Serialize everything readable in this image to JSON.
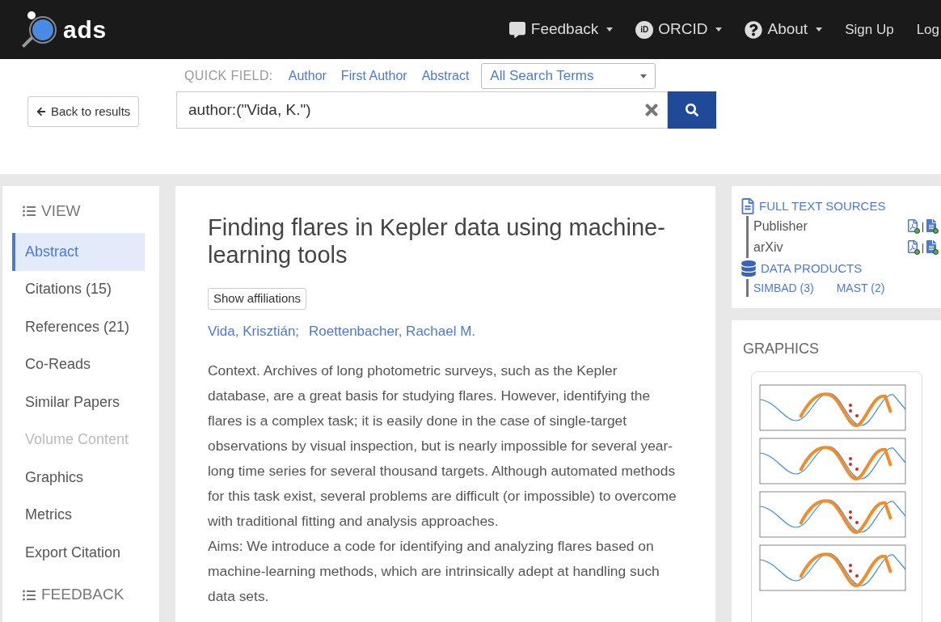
{
  "header": {
    "logo": "ads",
    "nav": [
      {
        "kind": "feedback",
        "label": "Feedback",
        "caret": true
      },
      {
        "kind": "orcid",
        "label": "ORCID",
        "caret": true,
        "badge": "iD"
      },
      {
        "kind": "about",
        "label": "About",
        "caret": true
      },
      {
        "kind": "plain",
        "label": "Sign Up",
        "caret": false
      },
      {
        "kind": "plain",
        "label": "Log",
        "caret": false
      }
    ]
  },
  "search": {
    "back": "Back to results",
    "quick_field_label": "QUICK FIELD:",
    "quick_fields": [
      "Author",
      "First Author",
      "Abstract"
    ],
    "terms_select": "All Search Terms",
    "query": "author:(\"Vida, K.\")"
  },
  "sidebar": {
    "view_heading": "VIEW",
    "items": [
      {
        "label": "Abstract",
        "selected": true,
        "disabled": false
      },
      {
        "label": "Citations (15)",
        "selected": false,
        "disabled": false
      },
      {
        "label": "References (21)",
        "selected": false,
        "disabled": false
      },
      {
        "label": "Co-Reads",
        "selected": false,
        "disabled": false
      },
      {
        "label": "Similar Papers",
        "selected": false,
        "disabled": false
      },
      {
        "label": "Volume Content",
        "selected": false,
        "disabled": true
      },
      {
        "label": "Graphics",
        "selected": false,
        "disabled": false
      },
      {
        "label": "Metrics",
        "selected": false,
        "disabled": false
      },
      {
        "label": "Export Citation",
        "selected": false,
        "disabled": false
      }
    ],
    "feedback_heading": "FEEDBACK"
  },
  "article": {
    "title": "Finding flares in Kepler data using machine-learning tools",
    "affiliations_button": "Show affiliations",
    "authors": [
      "Vida, Krisztián;",
      "Roettenbacher, Rachael M."
    ],
    "abstract": [
      "Context. Archives of long photometric surveys, such as the Kepler database, are a great basis for studying flares. However, identifying the flares is a complex task; it is easily done in the case of single-target observations by visual inspection, but is nearly impossible for several year-long time series for several thousand targets. Although automated methods for this task exist, several problems are difficult (or impossible) to overcome with traditional fitting and analysis approaches.",
      "Aims: We introduce a code for identifying and analyzing flares based on machine-learning methods, which are intrinsically adept at handling such data sets."
    ]
  },
  "full_text": {
    "heading": "FULL TEXT SOURCES",
    "sources": [
      {
        "label": "Publisher",
        "separator": "|"
      },
      {
        "label": "arXiv",
        "separator": "|"
      }
    ],
    "data_heading": "DATA PRODUCTS",
    "products": [
      "SIMBAD (3)",
      "MAST (2)"
    ]
  },
  "graphics": {
    "heading": "GRAPHICS"
  }
}
